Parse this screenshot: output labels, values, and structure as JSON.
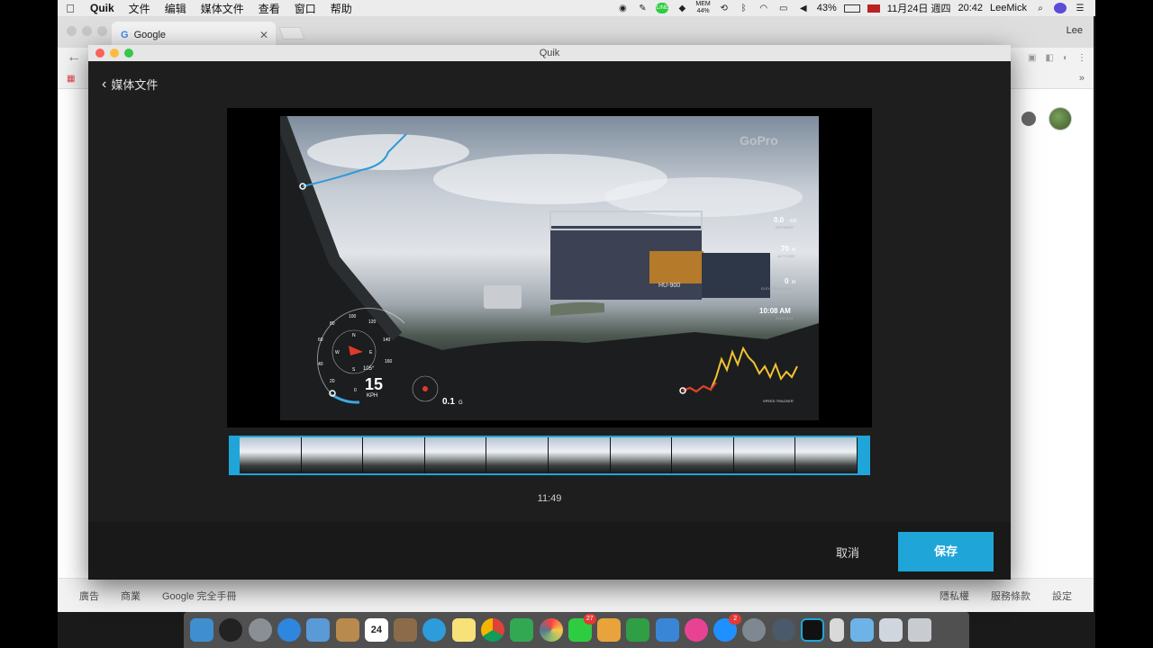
{
  "menubar": {
    "items": [
      "Quik",
      "文件",
      "编辑",
      "媒体文件",
      "查看",
      "窗口",
      "帮助"
    ],
    "mem_label": "MEM",
    "mem_value": "44%",
    "battery": "43%",
    "date": "11月24日 週四",
    "time": "20:42",
    "user": "LeeMick"
  },
  "browser": {
    "tab_title": "Google",
    "profile_label": "Lee",
    "footer_left": [
      "廣告",
      "商業",
      "Google 完全手冊"
    ],
    "footer_right": [
      "隱私權",
      "服務條款",
      "設定"
    ]
  },
  "quik": {
    "window_title": "Quik",
    "back_label": "媒体文件",
    "timecode": "11:49",
    "cancel_label": "取消",
    "save_label": "保存",
    "accent_color": "#1fa5d8"
  },
  "video_overlay": {
    "watermark": "GoPro",
    "gauge_ticks": [
      "0",
      "20",
      "40",
      "60",
      "80",
      "100",
      "120",
      "140",
      "160"
    ],
    "compass_n": "N",
    "compass_w": "W",
    "compass_e": "E",
    "compass_s": "S",
    "heading": "105°",
    "speed": "15",
    "speed_unit": "KPH",
    "g_force": "0.1",
    "g_unit": "G",
    "distance": "0.0",
    "distance_unit": "KM",
    "distance_label": "DISTANCE",
    "altitude": "70",
    "altitude_unit": "M",
    "altitude_label": "ALTITUDE",
    "elevation_gain": "0",
    "elevation_unit": "M",
    "elevation_label": "ELEVATION GAIN",
    "clock": "10:08 AM",
    "clock_date": "2016/11/22",
    "speed_tracker_label": "SPEED TRACKER",
    "truck_plate": "HU-900"
  },
  "dock": {
    "calendar_day": "24",
    "messages_badge": "27",
    "appstore_badge": "2"
  }
}
